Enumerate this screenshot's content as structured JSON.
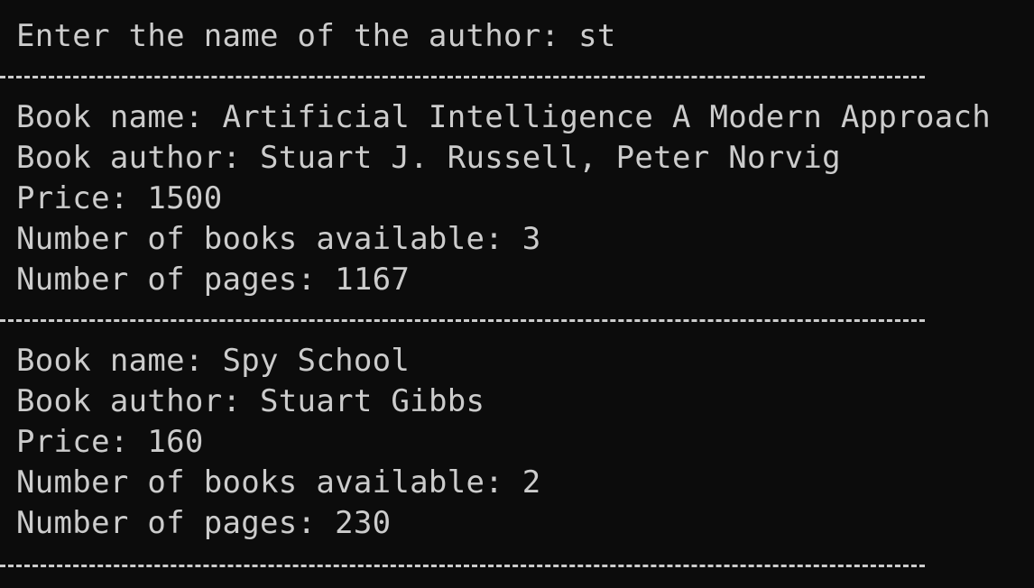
{
  "prompt": {
    "label": "Enter the name of the author: ",
    "input": "st"
  },
  "separator": "----------------------------------------------------------------",
  "results": [
    {
      "name_label": "Book name: ",
      "name": "Artificial Intelligence A Modern Approach",
      "author_label": "Book author: ",
      "author": "Stuart J. Russell, Peter Norvig",
      "price_label": "Price: ",
      "price": "1500",
      "available_label": "Number of books available: ",
      "available": "3",
      "pages_label": "Number of pages: ",
      "pages": "1167"
    },
    {
      "name_label": "Book name: ",
      "name": "Spy School",
      "author_label": "Book author: ",
      "author": "Stuart Gibbs",
      "price_label": "Price: ",
      "price": "160",
      "available_label": "Number of books available: ",
      "available": "2",
      "pages_label": "Number of pages: ",
      "pages": "230"
    }
  ]
}
